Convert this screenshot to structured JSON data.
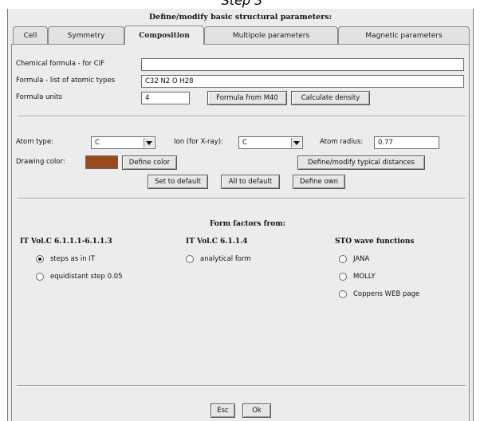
{
  "step_caption": "Step 3",
  "dialog": {
    "title": "Define/modify basic structural parameters:"
  },
  "tabs": [
    {
      "label": "Cell",
      "active": false
    },
    {
      "label": "Symmetry",
      "active": false
    },
    {
      "label": "Composition",
      "active": true
    },
    {
      "label": "Multipole parameters",
      "active": false
    },
    {
      "label": "Magnetic parameters",
      "active": false
    }
  ],
  "composition": {
    "chemical_formula_label": "Chemical formula - for CIF",
    "chemical_formula_value": "",
    "atomic_types_label": "Formula - list of atomic types",
    "atomic_types_value": "C32 N2 O H28",
    "formula_units_label": "Formula units",
    "formula_units_value": "4",
    "formula_from_m40_button": "Formula from M40",
    "calculate_density_button": "Calculate density"
  },
  "atom": {
    "atom_type_label": "Atom type:",
    "atom_type_value": "C",
    "ion_label": "Ion (for X-ray):",
    "ion_value": "C",
    "atom_radius_label": "Atom radius:",
    "atom_radius_value": "0.77",
    "drawing_color_label": "Drawing color:",
    "drawing_color_hex": "#9b4a1c",
    "define_color_button": "Define color",
    "define_distances_button": "Define/modify typical distances",
    "set_default_button": "Set to default",
    "all_default_button": "All to default",
    "define_own_button": "Define own"
  },
  "form_factors": {
    "title": "Form factors from:",
    "groups": [
      {
        "heading": "IT Vol.C 6.1.1.1-6.1.1.3",
        "options": [
          {
            "label": "steps as in IT",
            "selected": true
          },
          {
            "label": "equidistant step 0.05",
            "selected": false
          }
        ]
      },
      {
        "heading": "IT Vol.C 6.1.1.4",
        "options": [
          {
            "label": "analytical form",
            "selected": false
          }
        ]
      },
      {
        "heading": "STO wave functions",
        "options": [
          {
            "label": "JANA",
            "selected": false
          },
          {
            "label": "MOLLY",
            "selected": false
          },
          {
            "label": "Coppens WEB page",
            "selected": false
          }
        ]
      }
    ]
  },
  "footer": {
    "esc_button": "Esc",
    "ok_button": "Ok"
  }
}
